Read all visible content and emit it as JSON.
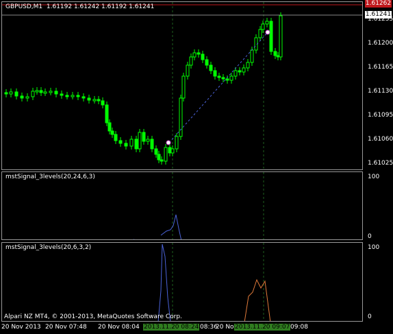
{
  "main_chart": {
    "title": "GBPUSD,M1  1.61192 1.61242 1.61192 1.61241",
    "price_scale": [
      "1.61235",
      "1.61200",
      "1.61165",
      "1.61130",
      "1.61095",
      "1.61060",
      "1.61025"
    ],
    "current_price": "1.61241",
    "top_price": "1.61262"
  },
  "indicator1": {
    "title": "mstSignal_3levels(20,24,6,3)",
    "scale_top": "100",
    "scale_bottom": "0"
  },
  "indicator2": {
    "title": "mstSignal_3levels(20,6,3,2)",
    "scale_top": "100",
    "scale_bottom": "0"
  },
  "time_axis": {
    "labels": [
      "20 Nov 2013",
      "20 Nov 07:48",
      "20 Nov 08:04",
      "08:36",
      "20 Nov 0",
      "09:08"
    ],
    "highlight_labels": [
      "2013.11.20 08:24",
      "2013.11.20 09:07"
    ]
  },
  "copyright": "Alpari NZ MT4, © 2001-2013, MetaQuotes Software Corp.",
  "colors": {
    "background": "#000000",
    "candle": "#00ff00",
    "signal_blue": "#4a62d8",
    "signal_orange": "#e07a3a",
    "grid_green": "#1e5f1e",
    "current_price_bg": "#ffffff",
    "top_price_bg": "#c0181c"
  }
}
